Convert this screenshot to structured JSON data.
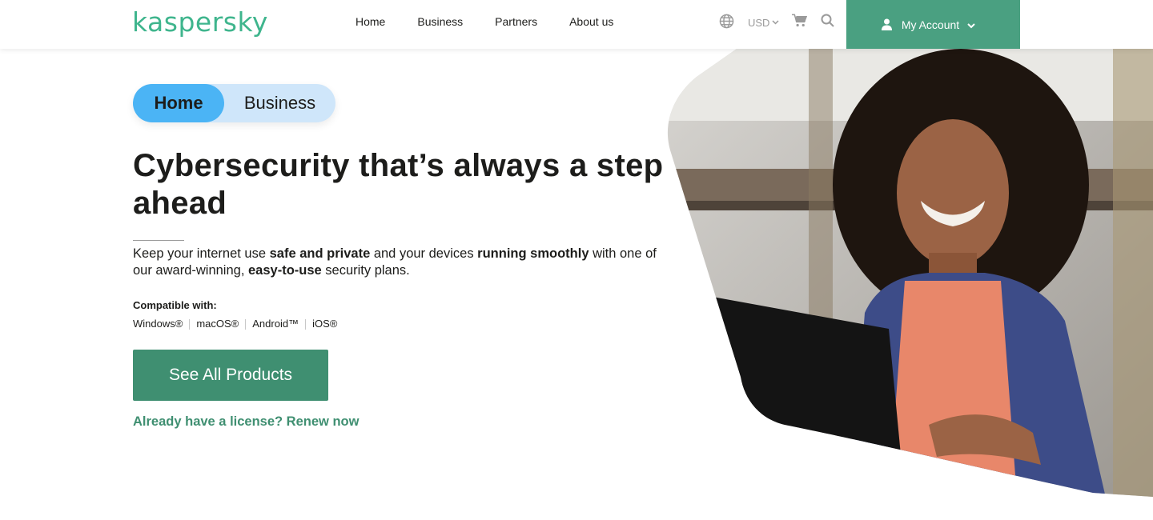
{
  "header": {
    "logo": "kaspersky",
    "nav": [
      "Home",
      "Business",
      "Partners",
      "About us"
    ],
    "currency": "USD",
    "account_label": "My Account"
  },
  "hero": {
    "toggle": {
      "home": "Home",
      "business": "Business"
    },
    "title": "Cybersecurity that’s always a step ahead",
    "lead": {
      "p1": "Keep your internet use ",
      "b1": "safe and private",
      "p2": " and your devices ",
      "b2": "running smoothly",
      "p3": " with one of our award-winning, ",
      "b3": "easy-to-use",
      "p4": " security plans."
    },
    "compatible_label": "Compatible with:",
    "platforms": [
      "Windows®",
      "macOS®",
      "Android™",
      "iOS®"
    ],
    "cta": "See All Products",
    "renew": "Already have a license? Renew now"
  },
  "colors": {
    "brand": "#3fb58d",
    "account_bg": "#4aa081",
    "cta_bg": "#3f8f71",
    "toggle_active": "#4bb4f5",
    "toggle_bg": "#cfe6fa"
  }
}
